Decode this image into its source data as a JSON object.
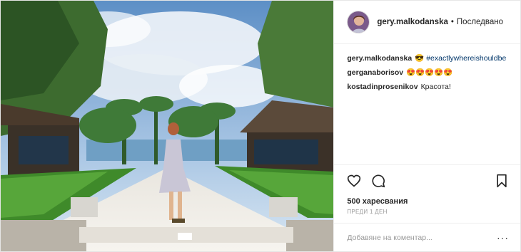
{
  "post": {
    "header": {
      "username": "gery.malkodanska",
      "separator": "•",
      "follow_status": "Последвано"
    },
    "comments": [
      {
        "user": "gery.malkodanska",
        "emoji": "😎",
        "hashtag": "#exactlywhereishouldbe",
        "text": ""
      },
      {
        "user": "gerganaborisov",
        "emoji": "",
        "hashtag": "",
        "text": "😍😍😍😍😍"
      },
      {
        "user": "kostadinprosenikov",
        "emoji": "",
        "hashtag": "",
        "text": "Красота!"
      }
    ],
    "likes_text": "500 харесвания",
    "timestamp": "ПРЕДИ 1 ДЕН",
    "add_comment_placeholder": "Добавяне на коментар...",
    "more_label": "···",
    "icons": {
      "like": "heart-icon",
      "comment": "comment-bubble-icon",
      "save": "bookmark-icon",
      "more": "more-options-icon"
    },
    "colors": {
      "border": "#efefef",
      "hashtag": "#003569",
      "muted": "#999999",
      "text": "#262626"
    }
  }
}
